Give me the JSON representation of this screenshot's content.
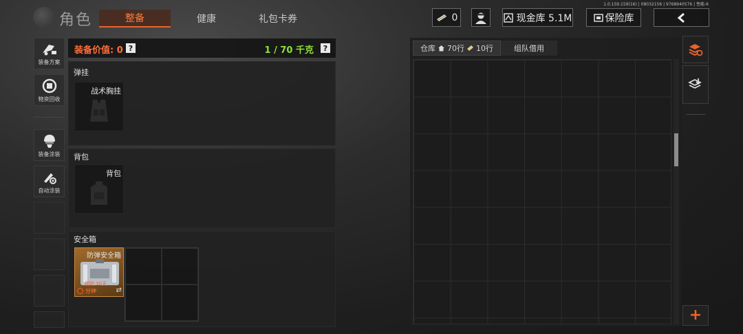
{
  "version_text": "1.0.159.159(16) | 08032156 | 9768940576 | 性能-6",
  "header": {
    "title": "角色",
    "tabs": [
      {
        "label": "整备",
        "active": true
      },
      {
        "label": "健康",
        "active": false
      },
      {
        "label": "礼包卡券",
        "active": false
      }
    ],
    "currency_count": "0",
    "cash_label": "现金库 5.1M",
    "vault_label": "保险库"
  },
  "sidebar": {
    "items": [
      {
        "label": "装备方案",
        "icon": "loadout-icon"
      },
      {
        "label": "物资回收",
        "icon": "recycle-icon"
      },
      {
        "label": "装备涂装",
        "icon": "helmet-paint-icon"
      },
      {
        "label": "自动涂装",
        "icon": "auto-paint-icon"
      }
    ]
  },
  "equipment": {
    "value_label": "装备价值: 0",
    "help": "?",
    "weight_label": "1 / 70 千克",
    "sections": [
      {
        "title": "弹挂",
        "slot_name": "战术胸挂"
      },
      {
        "title": "背包",
        "slot_name": "背包"
      },
      {
        "title": "安全箱",
        "slot_name": "防弹安全箱"
      }
    ],
    "safebox_badge": "分钟",
    "safebox_extra": "福利 30天"
  },
  "warehouse": {
    "tabs": [
      {
        "label": "仓库",
        "rows1": "70行",
        "rows2": "10行",
        "active": true
      },
      {
        "label": "组队借用",
        "active": false
      }
    ]
  },
  "right_strip": {
    "add_symbol": "+"
  },
  "colors": {
    "accent": "#e8642c",
    "weight_green": "#8fe03a",
    "value_orange": "#ff6e3a"
  }
}
